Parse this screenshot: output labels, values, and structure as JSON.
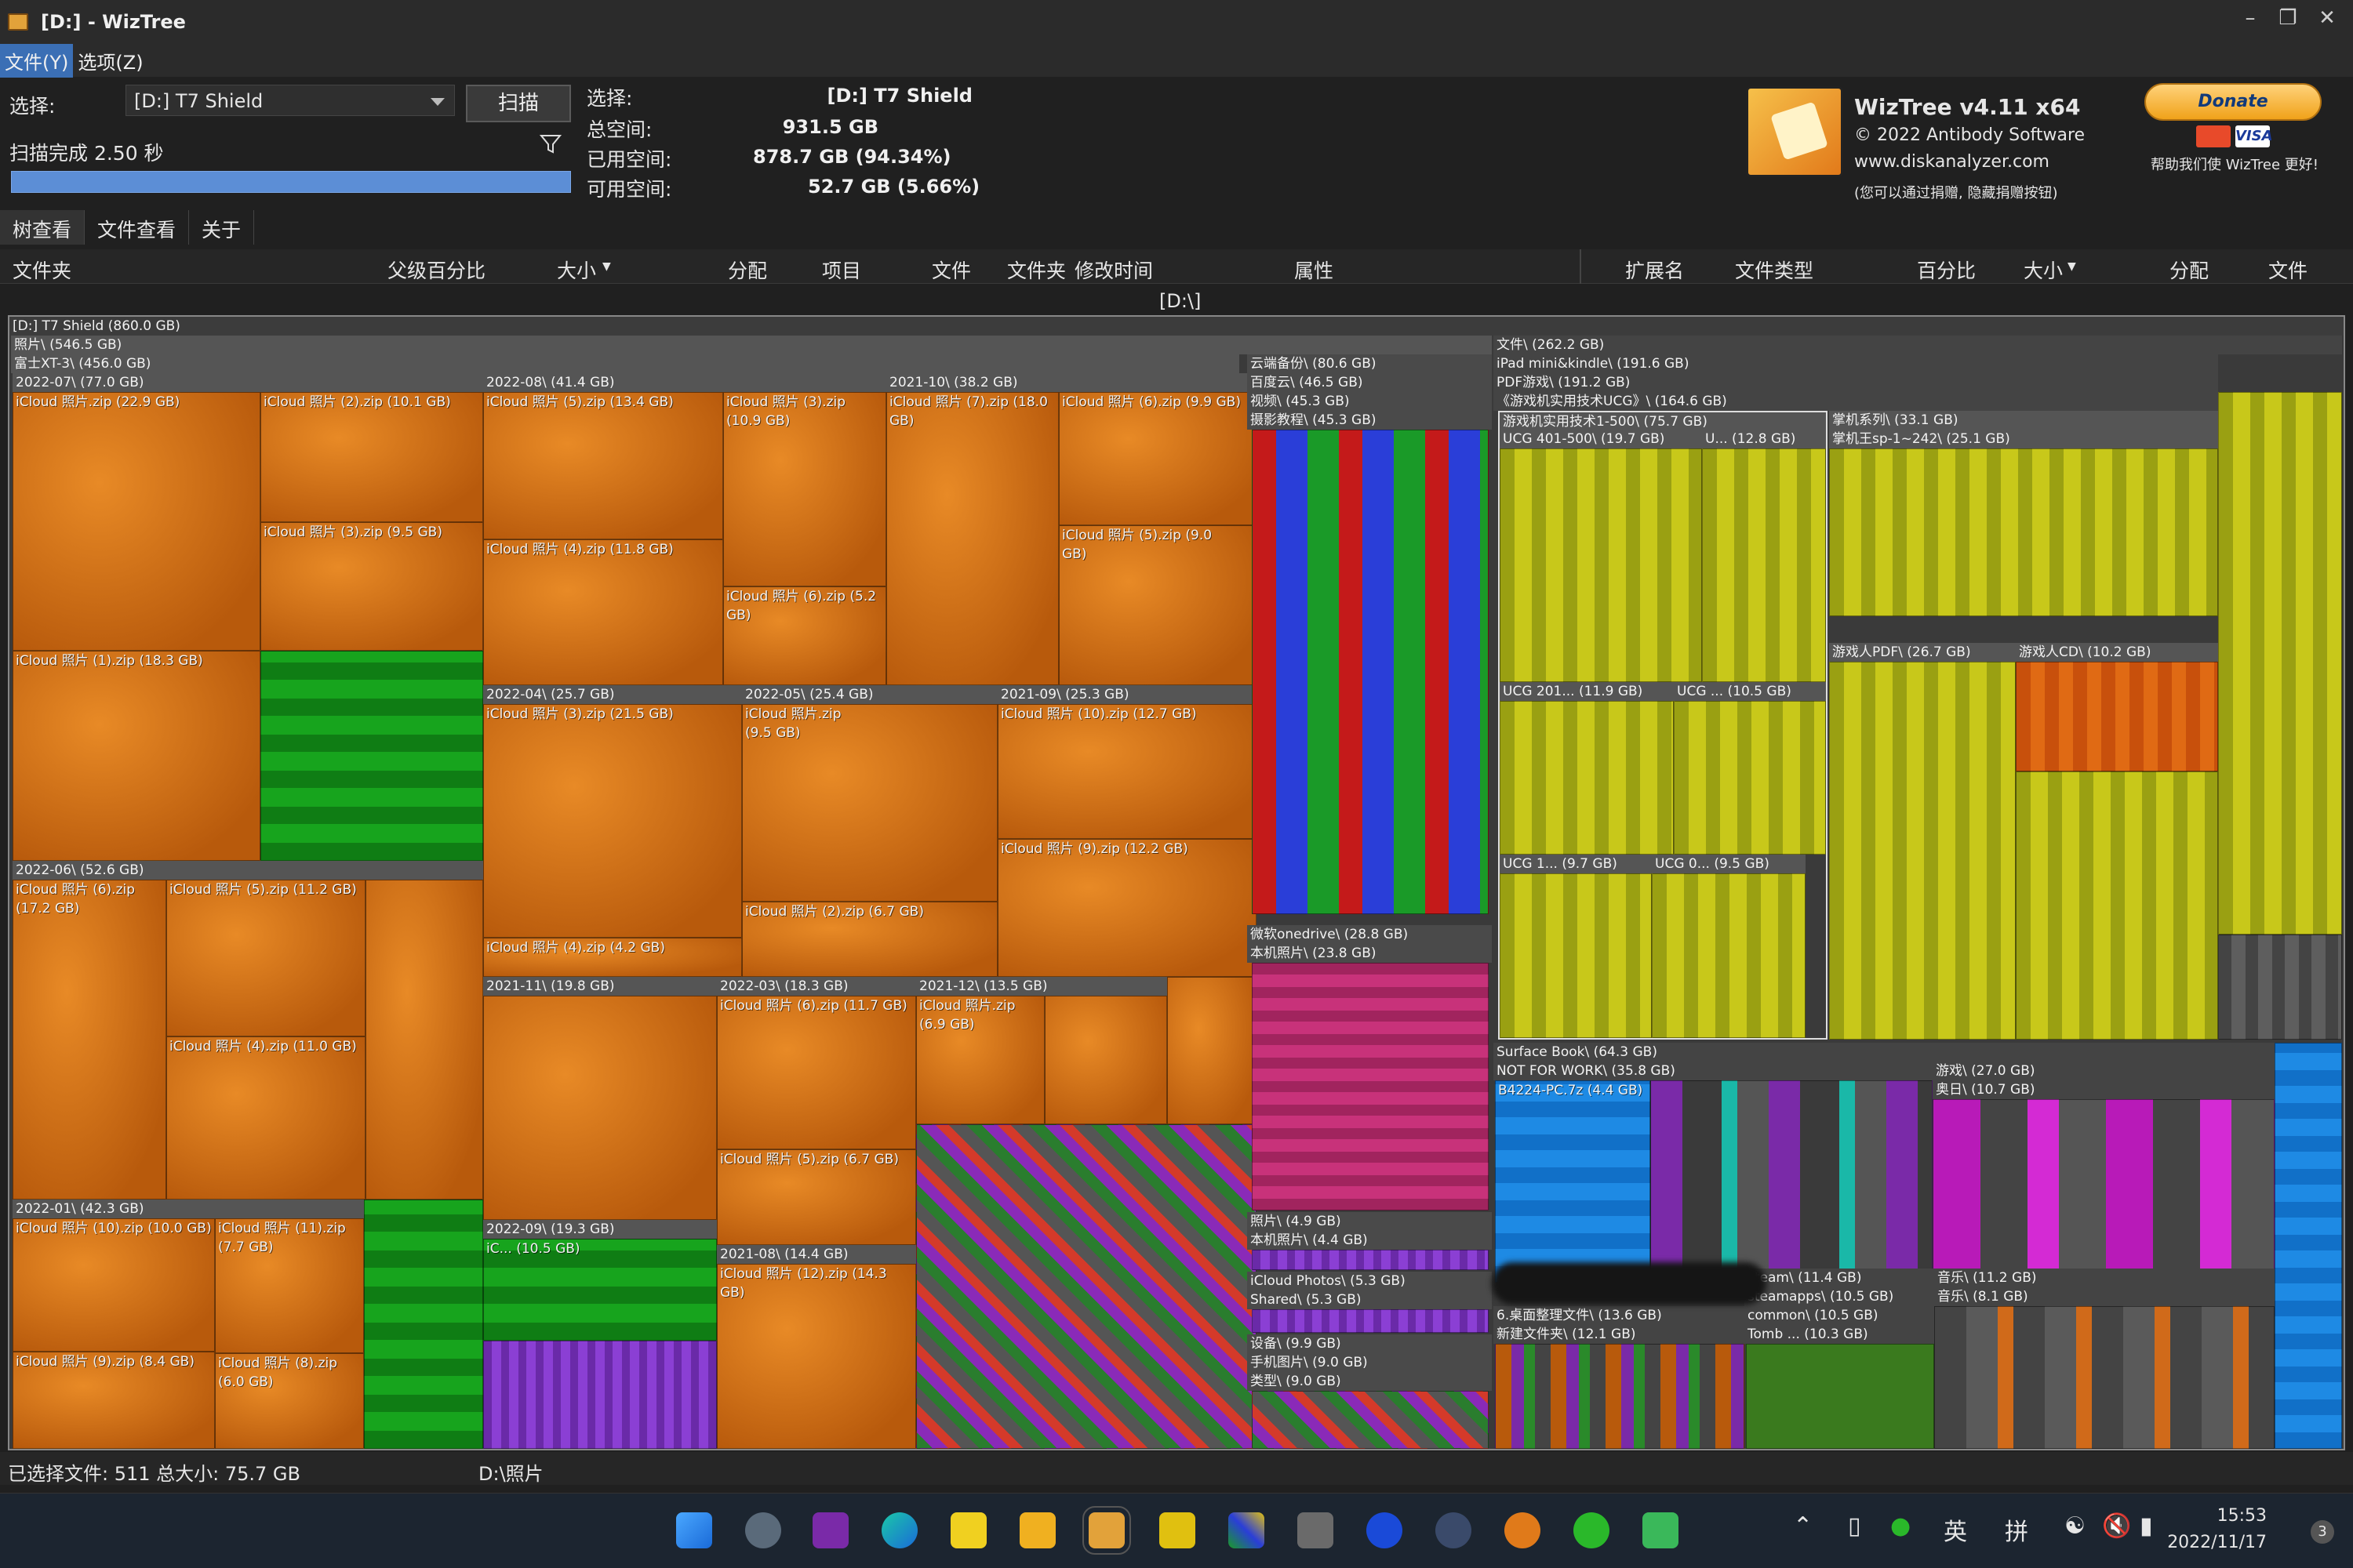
{
  "window": {
    "title": "[D:]  - WizTree"
  },
  "menu": {
    "file": "文件(Y)",
    "options": "选项(Z)"
  },
  "controls": {
    "select_label": "选择:",
    "drive_value": "[D:] T7 Shield",
    "scan_button": "扫描",
    "scan_status": "扫描完成 2.50 秒"
  },
  "drive_info": {
    "select_label": "选择:",
    "select_value": "[D:]   T7 Shield",
    "total_label": "总空间:",
    "total_value": "931.5 GB",
    "used_label": "已用空间:",
    "used_value": "878.7 GB  (94.34%)",
    "free_label": "可用空间:",
    "free_value": "52.7 GB  (5.66%)"
  },
  "branding": {
    "name": "WizTree v4.11 x64",
    "copyright": "© 2022 Antibody Software",
    "website": "www.diskanalyzer.com",
    "note": "(您可以通过捐赠, 隐藏捐赠按钮)",
    "donate": "Donate",
    "donate_note": "帮助我们使 WizTree 更好!",
    "visa": "VISA"
  },
  "tabs": [
    "树查看",
    "文件查看",
    "关于"
  ],
  "columns_left": [
    "文件夹",
    "父级百分比",
    "大小",
    "分配",
    "项目",
    "文件",
    "文件夹",
    "修改时间",
    "属性"
  ],
  "columns_right": [
    "扩展名",
    "文件类型",
    "百分比",
    "大小",
    "分配",
    "文件"
  ],
  "path": "[D:\\]",
  "treemap": {
    "root": "[D:] T7 Shield  (860.0 GB)",
    "photos": "照片\\ (546.5 GB)",
    "fuji": "富士XT-3\\ (456.0 GB)",
    "m2022_07": "2022-07\\ (77.0 GB)",
    "f_icloud_zip": "iCloud 照片.zip (22.9 GB)",
    "f_icloud2": "iCloud 照片 (2).zip (10.1 GB)",
    "f_icloud3": "iCloud 照片 (3).zip (9.5 GB)",
    "f_icloud1": "iCloud 照片 (1).zip (18.3 GB)",
    "m2022_08": "2022-08\\ (41.4 GB)",
    "f08_5": "iCloud 照片 (5).zip (13.4 GB)",
    "f08_3": "iCloud 照片 (3).zip (10.9 GB)",
    "f08_4": "iCloud 照片 (4).zip (11.8 GB)",
    "f08_6": "iCloud 照片 (6).zip (5.2 GB)",
    "m2021_10": "2021-10\\ (38.2 GB)",
    "f10_7": "iCloud 照片 (7).zip (18.0 GB)",
    "f10_6": "iCloud 照片 (6).zip (9.9 GB)",
    "f10_5": "iCloud 照片 (5).zip (9.0 GB)",
    "m2022_04": "2022-04\\ (25.7 GB)",
    "f04_3": "iCloud 照片 (3).zip (21.5 GB)",
    "f04_4": "iCloud 照片 (4).zip (4.2 GB)",
    "m2022_05": "2022-05\\ (25.4 GB)",
    "f05_zip": "iCloud 照片.zip (9.5 GB)",
    "f05_2": "iCloud 照片 (2).zip (6.7 GB)",
    "m2021_09": "2021-09\\ (25.3 GB)",
    "f09_10": "iCloud 照片 (10).zip (12.7 GB)",
    "f09_9": "iCloud 照片 (9).zip (12.2 GB)",
    "m2022_06": "2022-06\\ (52.6 GB)",
    "f06_6": "iCloud 照片 (6).zip (17.2 GB)",
    "f06_5": "iCloud 照片 (5).zip (11.2 GB)",
    "f06_4": "iCloud 照片 (4).zip (11.0 GB)",
    "m2021_11": "2021-11\\ (19.8 GB)",
    "m2022_03": "2022-03\\ (18.3 GB)",
    "f03_6": "iCloud 照片 (6).zip (11.7 GB)",
    "f03_5": "iCloud 照片 (5).zip (6.7 GB)",
    "m2021_12": "2021-12\\ (13.5 GB)",
    "f12_zip": "iCloud 照片.zip (6.9 GB)",
    "m2022_01": "2022-01\\ (42.3 GB)",
    "f01_10": "iCloud 照片 (10).zip (10.0 GB)",
    "f01_11": "iCloud 照片 (11).zip (7.7 GB)",
    "f01_9": "iCloud 照片 (9).zip (8.4 GB)",
    "f01_8": "iCloud 照片 (8).zip (6.0 GB)",
    "m2022_09": "2022-09\\ (19.3 GB)",
    "f09_ic": "iC... (10.5 GB)",
    "m2021_08": "2021-08\\ (14.4 GB)",
    "f08_12": "iCloud 照片 (12).zip (14.3 GB)",
    "cloud_backup": "云端备份\\ (80.6 GB)",
    "baidu": "百度云\\ (46.5 GB)",
    "video": "视频\\ (45.3 GB)",
    "photo_course": "摄影教程\\ (45.3 GB)",
    "onedrive": "微软onedrive\\ (28.8 GB)",
    "local_photos": "本机照片\\ (23.8 GB)",
    "photos2": "照片\\ (4.9 GB)",
    "local_photos2": "本机照片\\ (4.4 GB)",
    "icloud_photos": "iCloud Photos\\ (5.3 GB)",
    "shared": "Shared\\ (5.3 GB)",
    "devices": "设备\\ (9.9 GB)",
    "phone_pics": "手机图片\\ (9.0 GB)",
    "category": "类型\\ (9.0 GB)",
    "files": "文件\\ (262.2 GB)",
    "ipad": "iPad mini&kindle\\ (191.6 GB)",
    "pdf_games": "PDF游戏\\ (191.2 GB)",
    "game_tech": "《游戏机实用技术UCG》\\ (164.6 GB)",
    "ucg_1_500": "游戏机实用技术1-500\\ (75.7 GB)",
    "ucg_401": "UCG 401-500\\ (19.7 GB)",
    "ucg_u": "U... (12.8 GB)",
    "ucg_201": "UCG 201... (11.9 GB)",
    "ucg_dot": "UCG ... (10.5 GB)",
    "ucg_1": "UCG 1... (9.7 GB)",
    "ucg_0": "UCG 0... (9.5 GB)",
    "handheld": "掌机系列\\ (33.1 GB)",
    "handheld_king": "掌机王sp-1~242\\ (25.1 GB)",
    "gamer_pdf": "游戏人PDF\\ (26.7 GB)",
    "gamer_cd": "游戏人CD\\ (10.2 GB)",
    "surface": "Surface Book\\ (64.3 GB)",
    "not_for_work": "NOT FOR WORK\\ (35.8 GB)",
    "b4224": "B4224-PC.7z (4.4 GB)",
    "games": "游戏\\ (27.0 GB)",
    "aoki": "奥日\\ (10.7 GB)",
    "desktop": "6.桌面整理文件\\ (13.6 GB)",
    "new_folder": "新建文件夹\\ (12.1 GB)",
    "steam": "steam\\ (11.4 GB)",
    "steamapps": "steamapps\\ (10.5 GB)",
    "common": "common\\ (10.5 GB)",
    "tomb": "Tomb ... (10.3 GB)",
    "music": "音乐\\ (11.2 GB)",
    "music2": "音乐\\ (8.1 GB)"
  },
  "status": {
    "selected": "已选择文件: 511   总大小: 75.7 GB",
    "path": "D:\\照片"
  },
  "taskbar": {
    "ime_en": "英",
    "ime_pin": "拼",
    "time": "15:53",
    "date": "2022/11/17",
    "badge": "3"
  },
  "colors": {
    "accent": "#3b6fb5",
    "progress": "#5c8ed6",
    "orange": "#e07a1a",
    "yellow": "#b8b818",
    "green": "#17a41d"
  },
  "icons": [
    "start-icon",
    "settings-icon",
    "onenote-icon",
    "edge-icon",
    "sticky-notes-icon",
    "explorer-icon",
    "wiztree-icon",
    "pdf-icon",
    "app-icon",
    "eye-icon",
    "1password-icon",
    "camera-icon",
    "gift-icon",
    "wechat-icon",
    "download-icon"
  ]
}
